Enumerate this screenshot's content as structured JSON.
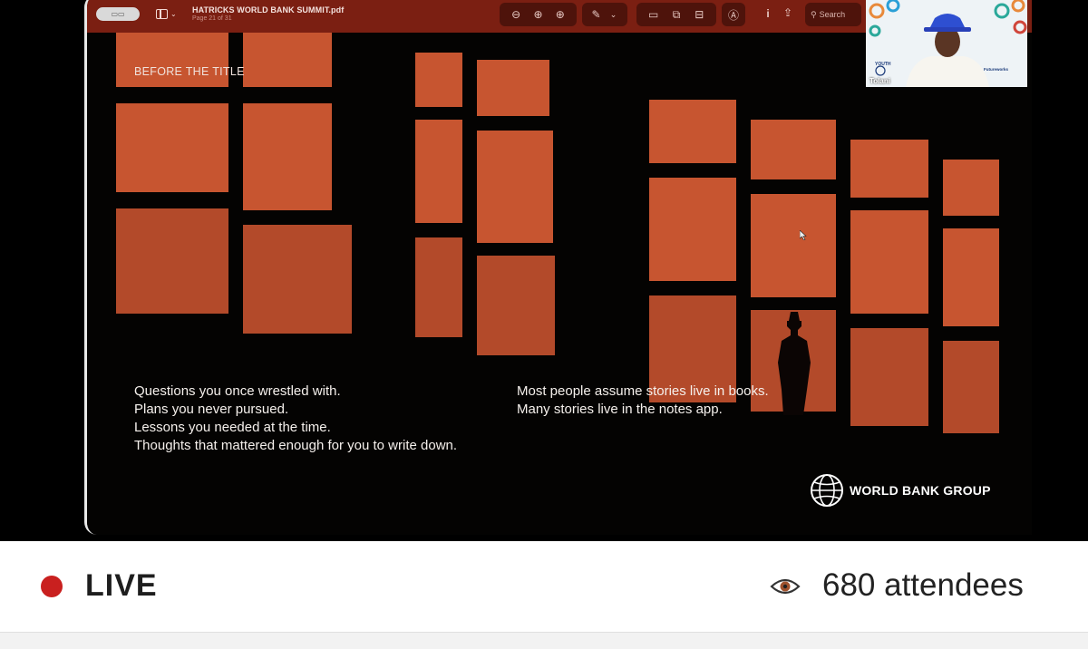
{
  "pdf_viewer": {
    "file_name": "HATRICKS WORLD BANK SUMMIT.pdf",
    "page_indicator": "Page 21 of 31",
    "search_placeholder": "Search",
    "toolbar_icons": [
      "sidebar-icon",
      "zoom-out-icon",
      "zoom-in-icon",
      "zoom-fit-icon",
      "markup-pen-icon",
      "chevron-down-icon",
      "highlight-icon",
      "rotate-icon",
      "edit-box-icon",
      "annotate-icon",
      "info-icon",
      "share-icon",
      "search-icon"
    ]
  },
  "slide": {
    "kicker": "BEFORE THE TITLE",
    "left_lines": [
      "Questions you once wrestled with.",
      "Plans you never pursued.",
      "Lessons you needed at the time.",
      "Thoughts that mattered enough for you to write down."
    ],
    "right_lines": [
      "Most people assume stories live in books.",
      "Many stories live in the notes app."
    ],
    "logo_text": "WORLD BANK GROUP"
  },
  "webcam": {
    "participant_name": "Tolani"
  },
  "live_bar": {
    "status": "LIVE",
    "attendees": "680 attendees",
    "status_color": "#c9201f"
  }
}
